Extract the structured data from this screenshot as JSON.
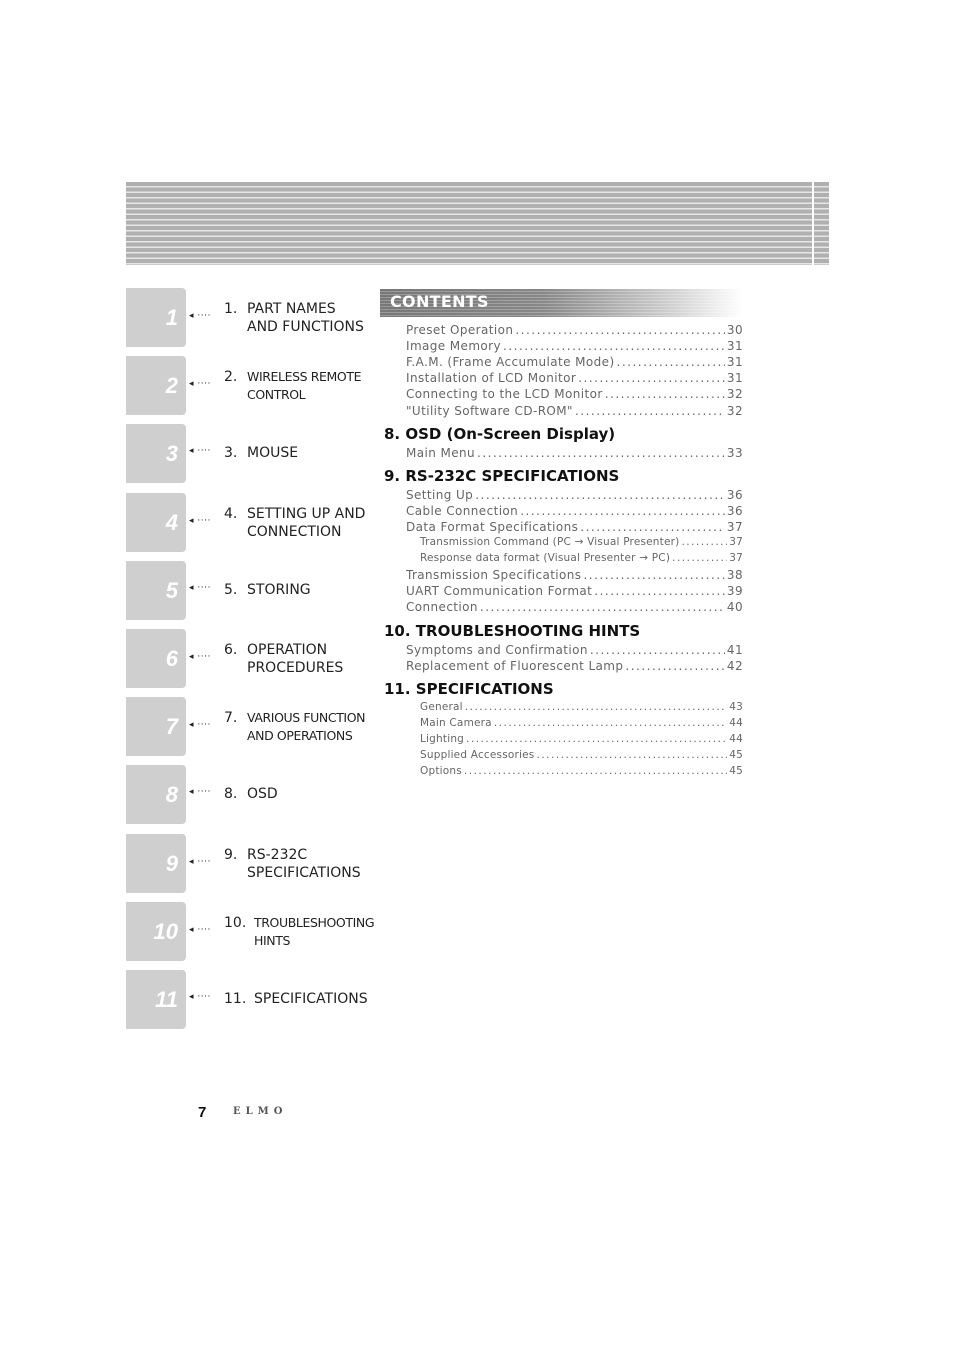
{
  "tabs": [
    {
      "num": "1",
      "chapter_no": "1.",
      "title": "PART NAMES\nAND FUNCTIONS",
      "small": false
    },
    {
      "num": "2",
      "chapter_no": "2.",
      "title": "WIRELESS REMOTE\nCONTROL",
      "small": true
    },
    {
      "num": "3",
      "chapter_no": "3.",
      "title": "MOUSE",
      "small": false
    },
    {
      "num": "4",
      "chapter_no": "4.",
      "title": "SETTING UP AND\nCONNECTION",
      "small": false
    },
    {
      "num": "5",
      "chapter_no": "5.",
      "title": "STORING",
      "small": false
    },
    {
      "num": "6",
      "chapter_no": "6.",
      "title": "OPERATION\nPROCEDURES",
      "small": false
    },
    {
      "num": "7",
      "chapter_no": "7.",
      "title": "VARIOUS FUNCTION\nAND OPERATIONS",
      "small": true
    },
    {
      "num": "8",
      "chapter_no": "8.",
      "title": "OSD",
      "small": false
    },
    {
      "num": "9",
      "chapter_no": "9.",
      "title": "RS-232C\nSPECIFICATIONS",
      "small": false
    },
    {
      "num": "10",
      "chapter_no": "10.",
      "title": "TROUBLESHOOTING\nHINTS",
      "small": true
    },
    {
      "num": "11",
      "chapter_no": "11.",
      "title": "SPECIFICATIONS",
      "small": false
    }
  ],
  "arrow_glyph": "◂ ····",
  "contents": {
    "title": "CONTENTS",
    "continued_entries": [
      {
        "label": "Preset Operation",
        "page": "30"
      },
      {
        "label": "Image Memory",
        "page": "31"
      },
      {
        "label": "F.A.M. (Frame Accumulate Mode)",
        "page": "31"
      },
      {
        "label": "Installation of LCD Monitor",
        "page": "31"
      },
      {
        "label": "Connecting to the LCD Monitor",
        "page": "32"
      },
      {
        "label": "\"Utility Software CD-ROM\"",
        "page": "32"
      }
    ],
    "sections": [
      {
        "heading": "8. OSD (On-Screen Display)",
        "entries": [
          {
            "label": "Main Menu",
            "page": "33",
            "sub": false
          }
        ]
      },
      {
        "heading": "9. RS-232C SPECIFICATIONS",
        "entries": [
          {
            "label": "Setting Up",
            "page": "36",
            "sub": false
          },
          {
            "label": "Cable Connection",
            "page": "36",
            "sub": false
          },
          {
            "label": "Data Format Specifications",
            "page": "37",
            "sub": false
          },
          {
            "label": "Transmission Command (PC → Visual Presenter)",
            "page": "37",
            "sub": true
          },
          {
            "label": "Response data format (Visual Presenter → PC)",
            "page": "37",
            "sub": true
          },
          {
            "label": "Transmission Specifications",
            "page": "38",
            "sub": false
          },
          {
            "label": "UART Communication Format",
            "page": "39",
            "sub": false
          },
          {
            "label": "Connection",
            "page": "40",
            "sub": false
          }
        ]
      },
      {
        "heading": "10. TROUBLESHOOTING HINTS",
        "entries": [
          {
            "label": "Symptoms and Confirmation",
            "page": "41",
            "sub": false
          },
          {
            "label": "Replacement of Fluorescent Lamp",
            "page": "42",
            "sub": false
          }
        ]
      },
      {
        "heading": "11. SPECIFICATIONS",
        "entries": [
          {
            "label": "General",
            "page": "43",
            "sub": true
          },
          {
            "label": "Main Camera",
            "page": "44",
            "sub": true
          },
          {
            "label": "Lighting",
            "page": "44",
            "sub": true
          },
          {
            "label": "Supplied Accessories",
            "page": "45",
            "sub": true
          },
          {
            "label": "Options",
            "page": "45",
            "sub": true
          }
        ]
      }
    ]
  },
  "footer": {
    "page_number": "7",
    "brand": "ELMO"
  }
}
